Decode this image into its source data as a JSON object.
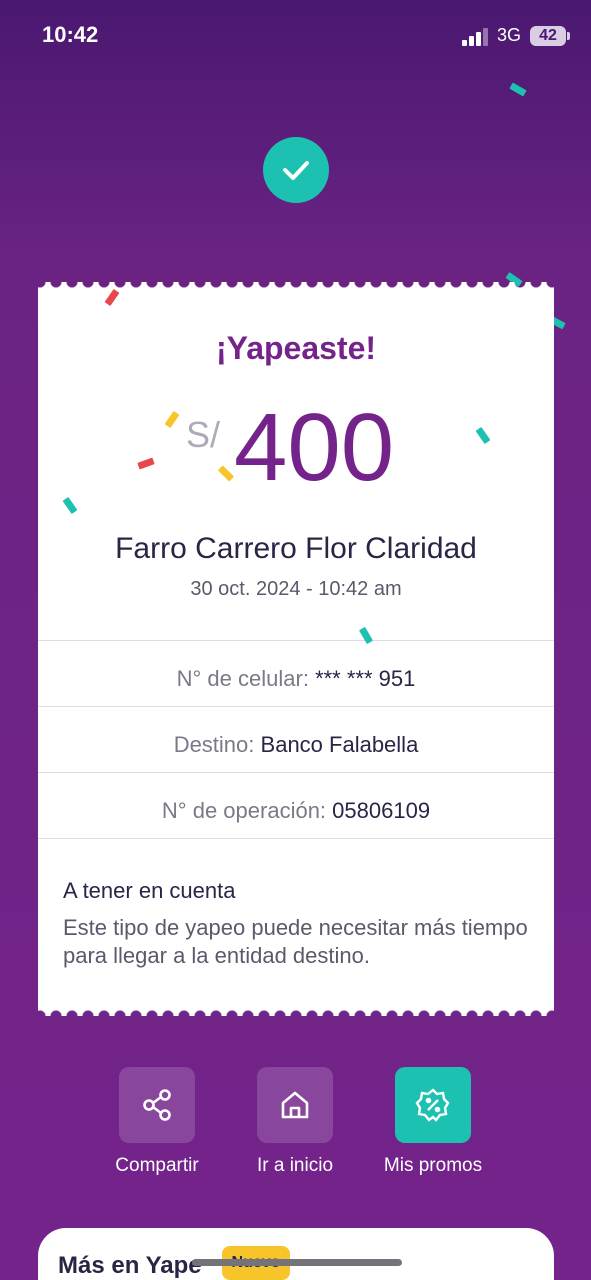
{
  "status_bar": {
    "time": "10:42",
    "network": "3G",
    "battery": "42"
  },
  "receipt": {
    "title": "¡Yapeaste!",
    "currency": "S/",
    "amount": "400",
    "recipient": "Farro Carrero Flor Claridad",
    "datetime": "30 oct. 2024 - 10:42 am",
    "details": [
      {
        "label": "N° de celular:",
        "value": "*** *** 951"
      },
      {
        "label": "Destino:",
        "value": "Banco Falabella"
      },
      {
        "label": "N° de operación:",
        "value": "05806109"
      }
    ],
    "note": {
      "title": "A tener en cuenta",
      "text": "Este tipo de yapeo puede necesitar más tiempo para llegar a la entidad destino."
    }
  },
  "actions": [
    {
      "label": "Compartir",
      "icon": "share-icon"
    },
    {
      "label": "Ir a inicio",
      "icon": "home-icon"
    },
    {
      "label": "Mis promos",
      "icon": "promo-badge-icon"
    }
  ],
  "more": {
    "title": "Más en Yape",
    "badge": "Nuevo"
  },
  "colors": {
    "brand_purple": "#74238a",
    "accent_teal": "#1dc1b2",
    "badge_yellow": "#f7c52a",
    "confetti_red": "#e8484d"
  }
}
